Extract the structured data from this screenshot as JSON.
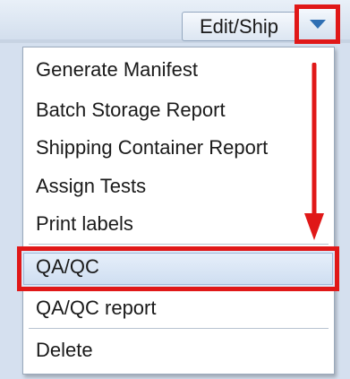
{
  "toolbar": {
    "edit_ship_label": "Edit/Ship"
  },
  "menu": {
    "items": [
      {
        "label": "Generate Manifest"
      },
      {
        "label": "Batch Storage Report"
      },
      {
        "label": "Shipping Container Report"
      },
      {
        "label": "Assign Tests"
      },
      {
        "label": "Print labels"
      },
      {
        "label": "QA/QC"
      },
      {
        "label": "QA/QC report"
      },
      {
        "label": "Delete"
      }
    ]
  },
  "colors": {
    "annotation_red": "#e01818",
    "highlight_blue": "#dbe7f6",
    "toolbar_blue": "#d5e0ef"
  },
  "icons": {
    "dropdown": "triangle-down-icon",
    "annotation_arrow": "arrow-down-icon"
  }
}
